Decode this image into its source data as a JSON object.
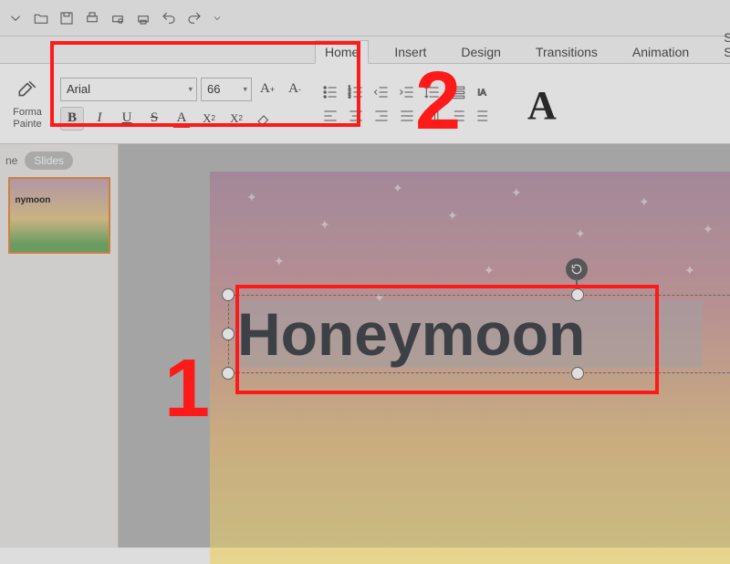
{
  "qat_icons": [
    "open",
    "save",
    "print-direct",
    "print",
    "print-preview",
    "undo",
    "redo",
    "dropdown"
  ],
  "tabs": {
    "home": "Home",
    "insert": "Insert",
    "design": "Design",
    "transitions": "Transitions",
    "animation": "Animation",
    "slideshow": "Slide Show"
  },
  "format_painter": {
    "line1": "Forma",
    "line2": "Painte"
  },
  "font": {
    "name": "Arial",
    "size": "66"
  },
  "sidebar": {
    "outline_tab": "ne",
    "slides_tab": "Slides",
    "thumb_title": "nymoon"
  },
  "slide": {
    "title_text": "Honeymoon"
  },
  "annotations": {
    "num1": "1",
    "num2": "2"
  },
  "text_styles_A": "A"
}
